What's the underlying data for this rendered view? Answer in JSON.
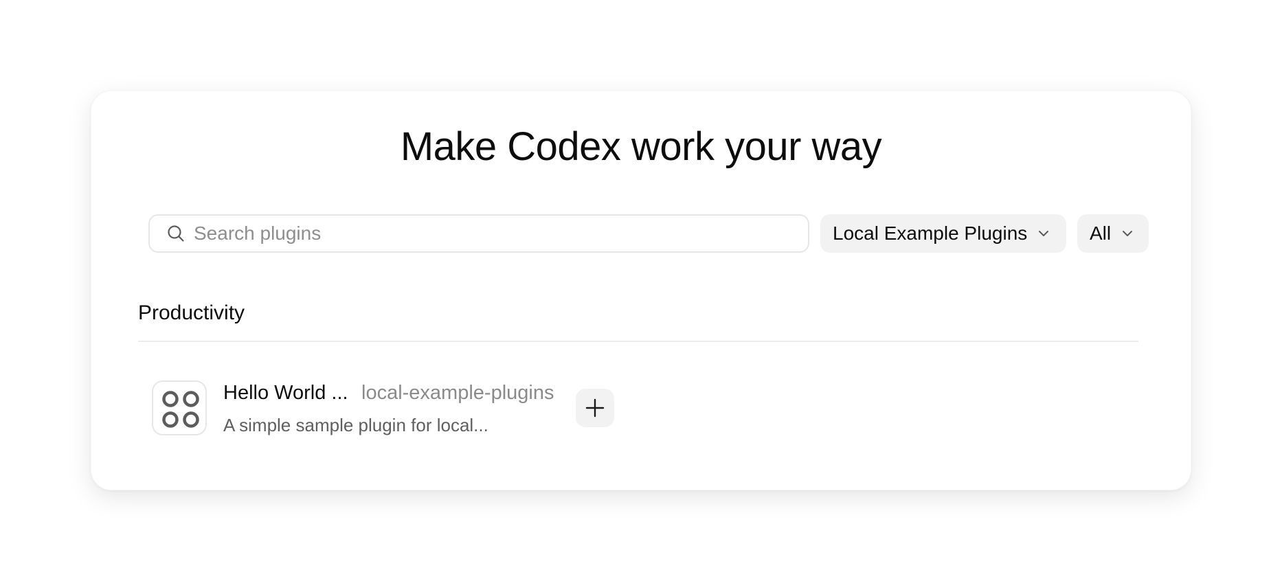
{
  "header": {
    "title": "Make Codex work your way"
  },
  "search": {
    "placeholder": "Search plugins",
    "value": ""
  },
  "filters": {
    "source_selected": "Local Example Plugins",
    "scope_selected": "All"
  },
  "sections": [
    {
      "title": "Productivity",
      "plugins": [
        {
          "name": "Hello World ...",
          "source": "local-example-plugins",
          "description": "A simple sample plugin for local...",
          "icon": "four-circles-icon"
        }
      ]
    }
  ],
  "icons": {
    "search": "search-icon",
    "chevron": "chevron-down-icon",
    "add": "plus-icon"
  },
  "colors": {
    "text": "#0d0d0d",
    "muted": "#8a8a8a",
    "pill_bg": "#f2f2f2",
    "border": "#e6e6e6"
  }
}
